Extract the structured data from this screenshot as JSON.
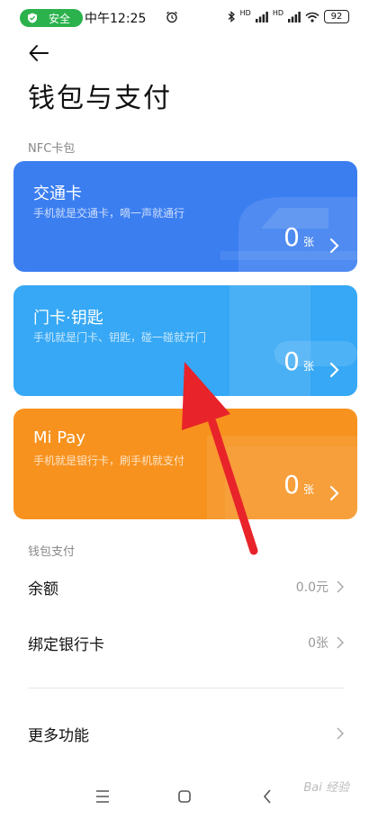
{
  "status_bar": {
    "safe_label": "安全",
    "time": "中午12:25",
    "network_labels": [
      "HD",
      "HD"
    ],
    "battery": "92"
  },
  "page": {
    "title": "钱包与支付"
  },
  "nfc_section": {
    "label": "NFC卡包",
    "cards": [
      {
        "title": "交通卡",
        "subtitle": "手机就是交通卡，嘀一声就通行",
        "count": "0",
        "unit": "张",
        "color": "#3b7ef0"
      },
      {
        "title": "门卡·钥匙",
        "subtitle": "手机就是门卡、钥匙，碰一碰就开门",
        "count": "0",
        "unit": "张",
        "color": "#36a8f5"
      },
      {
        "title": "Mi Pay",
        "subtitle": "手机就是银行卡，刷手机就支付",
        "count": "0",
        "unit": "张",
        "color": "#f7921e"
      }
    ]
  },
  "wallet_section": {
    "label": "钱包支付",
    "items": [
      {
        "label": "余额",
        "value": "0.0元"
      },
      {
        "label": "绑定银行卡",
        "value": "0张"
      }
    ]
  },
  "more": {
    "label": "更多功能"
  },
  "nav_bar": {
    "icons": [
      "menu-icon",
      "home-icon",
      "back-icon"
    ]
  },
  "watermark": "Bai 经验"
}
